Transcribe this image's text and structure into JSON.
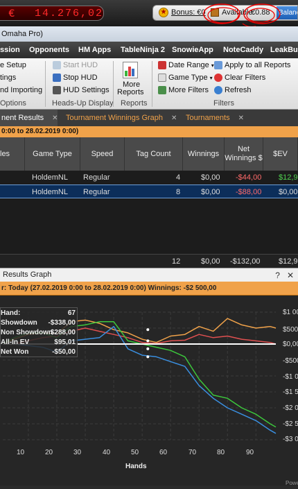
{
  "topbar": {
    "currency": "€",
    "balance": "14.276,02",
    "bonus_label": "Bonus: €0",
    "available_label": "Available:",
    "available_value": "€0.88",
    "balance_button": "Balance"
  },
  "window_title": "Omaha Pro)",
  "ribbon_tabs": [
    "ssion",
    "Opponents",
    "HM Apps",
    "TableNinja 2",
    "SnowieApp",
    "NoteCaddy",
    "LeakBus"
  ],
  "ribbon": {
    "options": {
      "items": [
        "e Setup",
        "tings",
        "nd Importing"
      ],
      "group": "Options"
    },
    "hud": {
      "items": [
        "Start HUD",
        "Stop HUD",
        "HUD Settings"
      ],
      "group": "Heads-Up Display"
    },
    "reports": {
      "button": "More",
      "button2": "Reports",
      "group": "Reports"
    },
    "filters": {
      "items": [
        "Date Range",
        "Game Type",
        "More Filters",
        "Apply to all Reports",
        "Clear Filters",
        "Refresh"
      ],
      "group": "Filters"
    }
  },
  "content_tabs": [
    "nent Results",
    "Tournament Winnings Graph",
    "Tournaments"
  ],
  "date_bar": "0:00 to 28.02.2019 0:00)",
  "table": {
    "headers": [
      "les",
      "Game Type",
      "Speed",
      "Tag Count",
      "Winnings",
      "Net Winnings $",
      "$EV"
    ],
    "rows": [
      {
        "game": "HoldemNL",
        "speed": "Regular",
        "tags": "4",
        "winnings": "$0,00",
        "net": "-$44,00",
        "ev": "$12,9"
      },
      {
        "game": "HoldemNL",
        "speed": "Regular",
        "tags": "8",
        "winnings": "$0,00",
        "net": "-$88,00",
        "ev": "$0,00"
      }
    ],
    "total": {
      "tags": "12",
      "winnings": "$0,00",
      "net": "-$132,00",
      "ev": "$12,9"
    }
  },
  "graph_window": {
    "title": "Results Graph",
    "info": "r: Today (27.02.2019 0:00 to 28.02.2019 0:00)  Winnings: -$2 500,00",
    "legend": [
      {
        "label": "Hand:",
        "value": "67",
        "color": "#ffffff"
      },
      {
        "label": "Showdown",
        "value": "-$338,00",
        "color": "#3a8fe0"
      },
      {
        "label": "Non Showdown",
        "value": "$288,00",
        "color": "#e05050"
      },
      {
        "label": "All-In EV",
        "value": "$95,01",
        "color": "#f0a24a"
      },
      {
        "label": "Net Won",
        "value": "-$50,00",
        "color": "#3cc83c"
      }
    ],
    "y_ticks": [
      "$1 00",
      "$500",
      "$0,00",
      "-$500",
      "-$1 0",
      "-$1 5",
      "-$2 0",
      "-$2 5",
      "-$3 0"
    ],
    "x_ticks": [
      "10",
      "20",
      "30",
      "40",
      "50",
      "60",
      "70",
      "80",
      "90"
    ],
    "x_title": "Hands",
    "footer": "Power"
  },
  "chart_data": {
    "type": "line",
    "xlabel": "Hands",
    "xlim": [
      1,
      97
    ],
    "ylim": [
      -3000,
      1000
    ],
    "series": [
      {
        "name": "All-In EV",
        "color": "#f0a24a",
        "x": [
          1,
          5,
          10,
          15,
          20,
          25,
          30,
          35,
          40,
          45,
          50,
          55,
          60,
          65,
          70,
          75,
          80,
          85,
          90,
          95,
          97
        ],
        "y": [
          0,
          150,
          300,
          350,
          320,
          700,
          750,
          650,
          450,
          350,
          150,
          50,
          250,
          300,
          550,
          400,
          800,
          600,
          500,
          550,
          500
        ]
      },
      {
        "name": "Non Showdown",
        "color": "#e05050",
        "x": [
          1,
          5,
          10,
          15,
          20,
          25,
          30,
          35,
          40,
          45,
          50,
          55,
          60,
          65,
          70,
          75,
          80,
          85,
          90,
          95,
          97
        ],
        "y": [
          0,
          0,
          100,
          200,
          250,
          400,
          500,
          400,
          300,
          200,
          50,
          20,
          100,
          120,
          300,
          200,
          250,
          150,
          100,
          50,
          0
        ]
      },
      {
        "name": "Net Won",
        "color": "#3cc83c",
        "x": [
          1,
          5,
          10,
          15,
          20,
          25,
          30,
          35,
          40,
          45,
          50,
          55,
          60,
          65,
          70,
          75,
          80,
          85,
          90,
          95,
          97
        ],
        "y": [
          0,
          200,
          350,
          350,
          200,
          550,
          600,
          700,
          700,
          100,
          0,
          -100,
          -200,
          -400,
          -1100,
          -1600,
          -1700,
          -2000,
          -2200,
          -2500,
          -2600
        ]
      },
      {
        "name": "Showdown",
        "color": "#3a8fe0",
        "x": [
          1,
          5,
          10,
          15,
          20,
          25,
          30,
          35,
          40,
          45,
          50,
          55,
          60,
          65,
          70,
          75,
          80,
          85,
          90,
          95,
          97
        ],
        "y": [
          0,
          0,
          -50,
          -100,
          -250,
          100,
          150,
          200,
          550,
          -150,
          -350,
          -400,
          -550,
          -700,
          -1300,
          -1700,
          -2000,
          -2200,
          -2400,
          -2700,
          -2800
        ]
      },
      {
        "name": "Zero",
        "color": "#ffffff",
        "x": [
          1,
          97
        ],
        "y": [
          0,
          0
        ]
      }
    ]
  }
}
